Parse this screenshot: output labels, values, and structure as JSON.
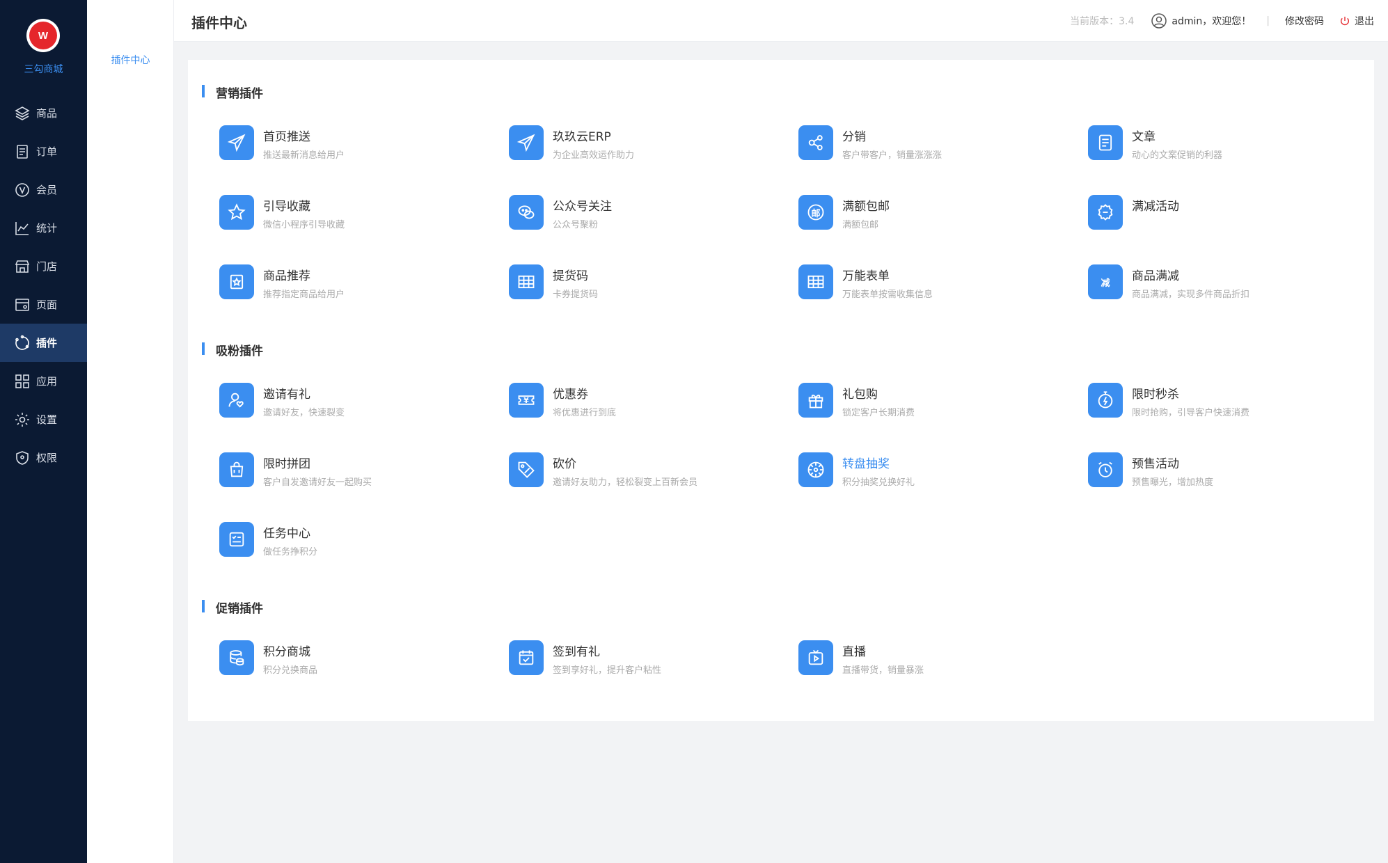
{
  "brand": {
    "name": "三勾商城",
    "logo_mark": "W"
  },
  "nav": [
    {
      "label": "商品",
      "icon": "layers-icon"
    },
    {
      "label": "订单",
      "icon": "document-icon"
    },
    {
      "label": "会员",
      "icon": "vip-icon"
    },
    {
      "label": "统计",
      "icon": "chart-line-icon"
    },
    {
      "label": "门店",
      "icon": "store-icon"
    },
    {
      "label": "页面",
      "icon": "page-icon"
    },
    {
      "label": "插件",
      "icon": "plugin-icon",
      "active": true
    },
    {
      "label": "应用",
      "icon": "grid-icon"
    },
    {
      "label": "设置",
      "icon": "gear-icon"
    },
    {
      "label": "权限",
      "icon": "shield-icon"
    }
  ],
  "submenu": {
    "item": "插件中心"
  },
  "header": {
    "title": "插件中心",
    "version": "当前版本：3.4",
    "user": "admin，欢迎您！",
    "separator": "|",
    "change_password": "修改密码",
    "logout": "退出"
  },
  "sections": [
    {
      "title": "营销插件",
      "plugins": [
        {
          "name": "首页推送",
          "desc": "推送最新消息给用户",
          "icon": "paper-plane-icon"
        },
        {
          "name": "玖玖云ERP",
          "desc": "为企业高效运作助力",
          "icon": "paper-plane-icon"
        },
        {
          "name": "分销",
          "desc": "客户带客户，销量涨涨涨",
          "icon": "share-nodes-icon"
        },
        {
          "name": "文章",
          "desc": "动心的文案促销的利器",
          "icon": "article-icon"
        },
        {
          "name": "引导收藏",
          "desc": "微信小程序引导收藏",
          "icon": "star-icon"
        },
        {
          "name": "公众号关注",
          "desc": "公众号聚粉",
          "icon": "wechat-icon"
        },
        {
          "name": "满额包邮",
          "desc": "满额包邮",
          "icon": "mail-badge-icon",
          "glyph": "邮"
        },
        {
          "name": "满减活动",
          "desc": "",
          "icon": "discount-badge-icon"
        },
        {
          "name": "商品推荐",
          "desc": "推荐指定商品给用户",
          "icon": "recommend-icon"
        },
        {
          "name": "提货码",
          "desc": "卡券提货码",
          "icon": "table-icon"
        },
        {
          "name": "万能表单",
          "desc": "万能表单按需收集信息",
          "icon": "table-icon"
        },
        {
          "name": "商品满减",
          "desc": "商品满减，实现多件商品折扣",
          "icon": "reduce-icon",
          "glyph": "减"
        }
      ]
    },
    {
      "title": "吸粉插件",
      "plugins": [
        {
          "name": "邀请有礼",
          "desc": "邀请好友，快速裂变",
          "icon": "user-heart-icon"
        },
        {
          "name": "优惠券",
          "desc": "将优惠进行到底",
          "icon": "coupon-icon",
          "glyph": "¥"
        },
        {
          "name": "礼包购",
          "desc": "锁定客户长期消费",
          "icon": "gift-icon"
        },
        {
          "name": "限时秒杀",
          "desc": "限时抢购，引导客户快速消费",
          "icon": "stopwatch-icon"
        },
        {
          "name": "限时拼团",
          "desc": "客户自发邀请好友一起购买",
          "icon": "group-buy-icon"
        },
        {
          "name": "砍价",
          "desc": "邀请好友助力，轻松裂变上百新会员",
          "icon": "price-tag-icon"
        },
        {
          "name": "转盘抽奖",
          "desc": "积分抽奖兑换好礼",
          "icon": "wheel-icon",
          "highlight": true
        },
        {
          "name": "预售活动",
          "desc": "预售曝光，增加热度",
          "icon": "alarm-clock-icon"
        },
        {
          "name": "任务中心",
          "desc": "做任务挣积分",
          "icon": "task-list-icon"
        }
      ]
    },
    {
      "title": "促销插件",
      "plugins": [
        {
          "name": "积分商城",
          "desc": "积分兑换商品",
          "icon": "coins-icon"
        },
        {
          "name": "签到有礼",
          "desc": "签到享好礼，提升客户粘性",
          "icon": "calendar-check-icon"
        },
        {
          "name": "直播",
          "desc": "直播带货，销量暴涨",
          "icon": "tv-play-icon"
        }
      ]
    }
  ],
  "colors": {
    "sidebar": "#0b1a33",
    "accent": "#3b8ef0",
    "active_nav": "#1e3a66"
  }
}
